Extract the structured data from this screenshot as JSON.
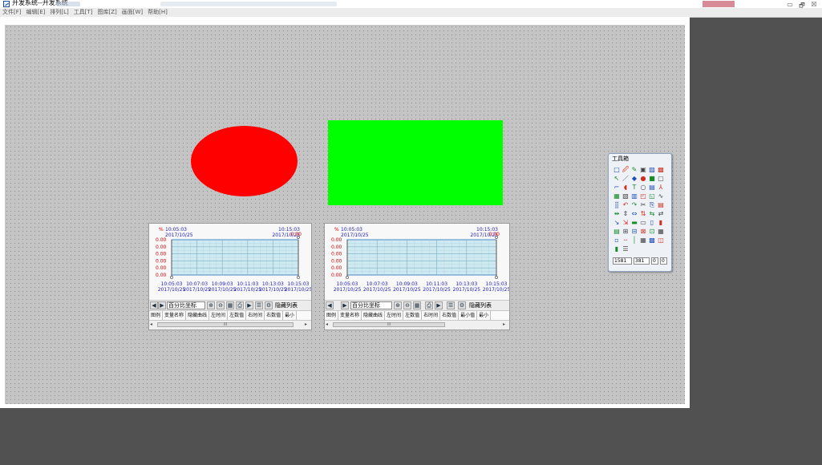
{
  "window": {
    "title": "开发系统--开发系统",
    "controls": [
      "▭",
      "🗗",
      "☒"
    ]
  },
  "menu": [
    "文件[F]",
    "编辑[E]",
    "排列[L]",
    "工具[T]",
    "图库[Z]",
    "画面[W]",
    "帮助[H]"
  ],
  "colors": {
    "ellipse": "#ff0000",
    "rectangle": "#00ff00",
    "plot_bg": "#cfe9f1",
    "grid": "#7fb3c8"
  },
  "trend1": {
    "pct": "%",
    "start_time": "10:05:03",
    "start_date": "2017/10/25",
    "end_time": "10:15:03",
    "end_date": "2017/10/25",
    "overlay": "0.00",
    "yvals": [
      "0.00",
      "0.00",
      "0.00",
      "0.00",
      "0.00",
      "0.00"
    ],
    "xtimes": [
      "10:05:03",
      "10:07:03",
      "10:09:03",
      "10:11:03",
      "10:13:03",
      "10:15:03"
    ],
    "xdates": [
      "2017/10/25",
      "2017/10/25",
      "2017/10/25",
      "2017/10/25",
      "2017/10/25",
      "2017/10/25"
    ],
    "toolbar_select": "百分比坐标",
    "toolbar_text": "隐藏列表",
    "headers": [
      "图例",
      "变量名称",
      "隐藏曲线",
      "左时间",
      "左数值",
      "右时间",
      "右数值",
      "最小"
    ],
    "scroll_mark": "III"
  },
  "trend2": {
    "pct": "%",
    "start_time": "10:05:03",
    "start_date": "2017/10/25",
    "end_time": "10:15:03",
    "end_date": "2017/10/25",
    "overlay": "0.00",
    "yvals": [
      "0.00",
      "0.00",
      "0.00",
      "0.00",
      "0.00",
      "0.00"
    ],
    "xtimes": [
      "10:05:03",
      "10:07:03",
      "10:09:03",
      "10:11:03",
      "10:13:03",
      "10:15:03"
    ],
    "xdates": [
      "2017/10/25",
      "2017/10/25",
      "2017/10/25",
      "2017/10/25",
      "2017/10/25",
      "2017/10/25"
    ],
    "toolbar_select": "百分比坐标",
    "toolbar_text": "隐藏列表",
    "headers": [
      "图例",
      "变量名称",
      "隐藏曲线",
      "左时间",
      "左数值",
      "右时间",
      "右数值",
      "最小值",
      "最小"
    ],
    "scroll_mark": "III"
  },
  "toolbox": {
    "title": "工具箱",
    "coords": [
      "1581",
      "381",
      "0",
      "0"
    ]
  }
}
